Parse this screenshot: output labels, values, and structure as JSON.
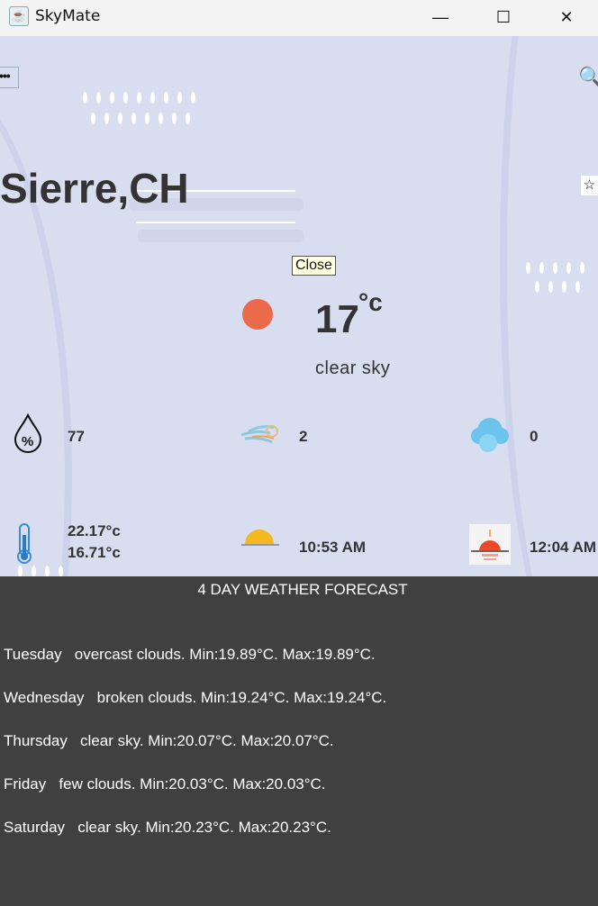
{
  "window": {
    "title": "SkyMate",
    "minimize": "—",
    "maximize": "☐",
    "close": "✕"
  },
  "header": {
    "menu_label": "•••",
    "search_icon": "🔍",
    "star_icon": "☆"
  },
  "location": "Sierre,CH",
  "tooltip": "Close",
  "current": {
    "temp": "17",
    "unit": "°c",
    "description": "clear sky",
    "accent": "#ec6a4c"
  },
  "details": {
    "humidity": "77",
    "wind": "2",
    "clouds": "0",
    "temp_max": "22.17°c",
    "temp_min": "16.71°c",
    "sunrise": "10:53 AM",
    "sunset": "12:04 AM"
  },
  "forecast": {
    "title": "4 DAY WEATHER FORECAST",
    "rows": [
      "Tuesday   overcast clouds. Min:19.89°C. Max:19.89°C.",
      "Wednesday   broken clouds. Min:19.24°C. Max:19.24°C.",
      "Thursday   clear sky. Min:20.07°C. Max:20.07°C.",
      "Friday   few clouds. Min:20.03°C. Max:20.03°C.",
      "Saturday   clear sky. Min:20.23°C. Max:20.23°C."
    ]
  }
}
